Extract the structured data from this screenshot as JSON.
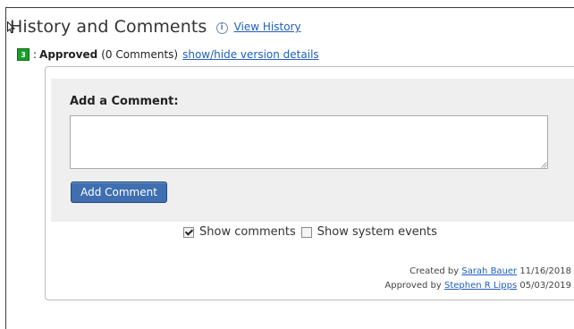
{
  "header": {
    "title": "History and Comments",
    "info_icon_glyph": "i",
    "view_history_label": "View History"
  },
  "version": {
    "number": "3",
    "badge_color": "#1a9e2a",
    "separator": ":",
    "status": "Approved",
    "comment_count": "(0 Comments)",
    "toggle_label": "show/hide version details"
  },
  "comment_form": {
    "label": "Add a Comment:",
    "textarea_value": "",
    "textarea_placeholder": "",
    "submit_label": "Add Comment",
    "button_color": "#3f6fb0"
  },
  "filters": {
    "show_comments": {
      "label": "Show comments",
      "checked": true
    },
    "show_system_events": {
      "label": "Show system events",
      "checked": false
    }
  },
  "footer": {
    "created_prefix": "Created by",
    "created_by": "Sarah Bauer",
    "created_date": "11/16/2018",
    "approved_prefix": "Approved by",
    "approved_by": "Stephen R Lipps",
    "approved_date": "05/03/2019"
  },
  "icons": [
    "mouse-cursor-icon",
    "info-icon",
    "resize-grip-icon",
    "checkbox-icon"
  ]
}
